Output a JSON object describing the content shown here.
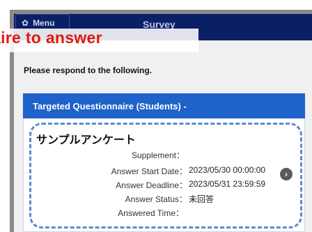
{
  "header": {
    "menu_label": "Menu",
    "gear_icon": "gear-icon",
    "title": "Survey",
    "overlay_caption": "aire to answer"
  },
  "main": {
    "instruction": "Please respond to the following."
  },
  "questionnaire": {
    "section_title": "Targeted Questionnaire (Students) -",
    "card_title": "サンプルアンケート",
    "fields": [
      {
        "label": "Supplement：",
        "value": ""
      },
      {
        "label": "Answer Start Date：",
        "value": "2023/05/30 00:00:00"
      },
      {
        "label": "Answer Deadline：",
        "value": "2023/05/31 23:59:59"
      },
      {
        "label": "Answer Status：",
        "value": "未回答"
      },
      {
        "label": "Answered Time：",
        "value": ""
      }
    ],
    "open_icon": "chevron-right-circle-icon"
  },
  "colors": {
    "header_bg": "#0b1f66",
    "section_header_bg": "#1f62c9",
    "card_border": "#5b8ad2",
    "caption_text": "#e0190f"
  }
}
